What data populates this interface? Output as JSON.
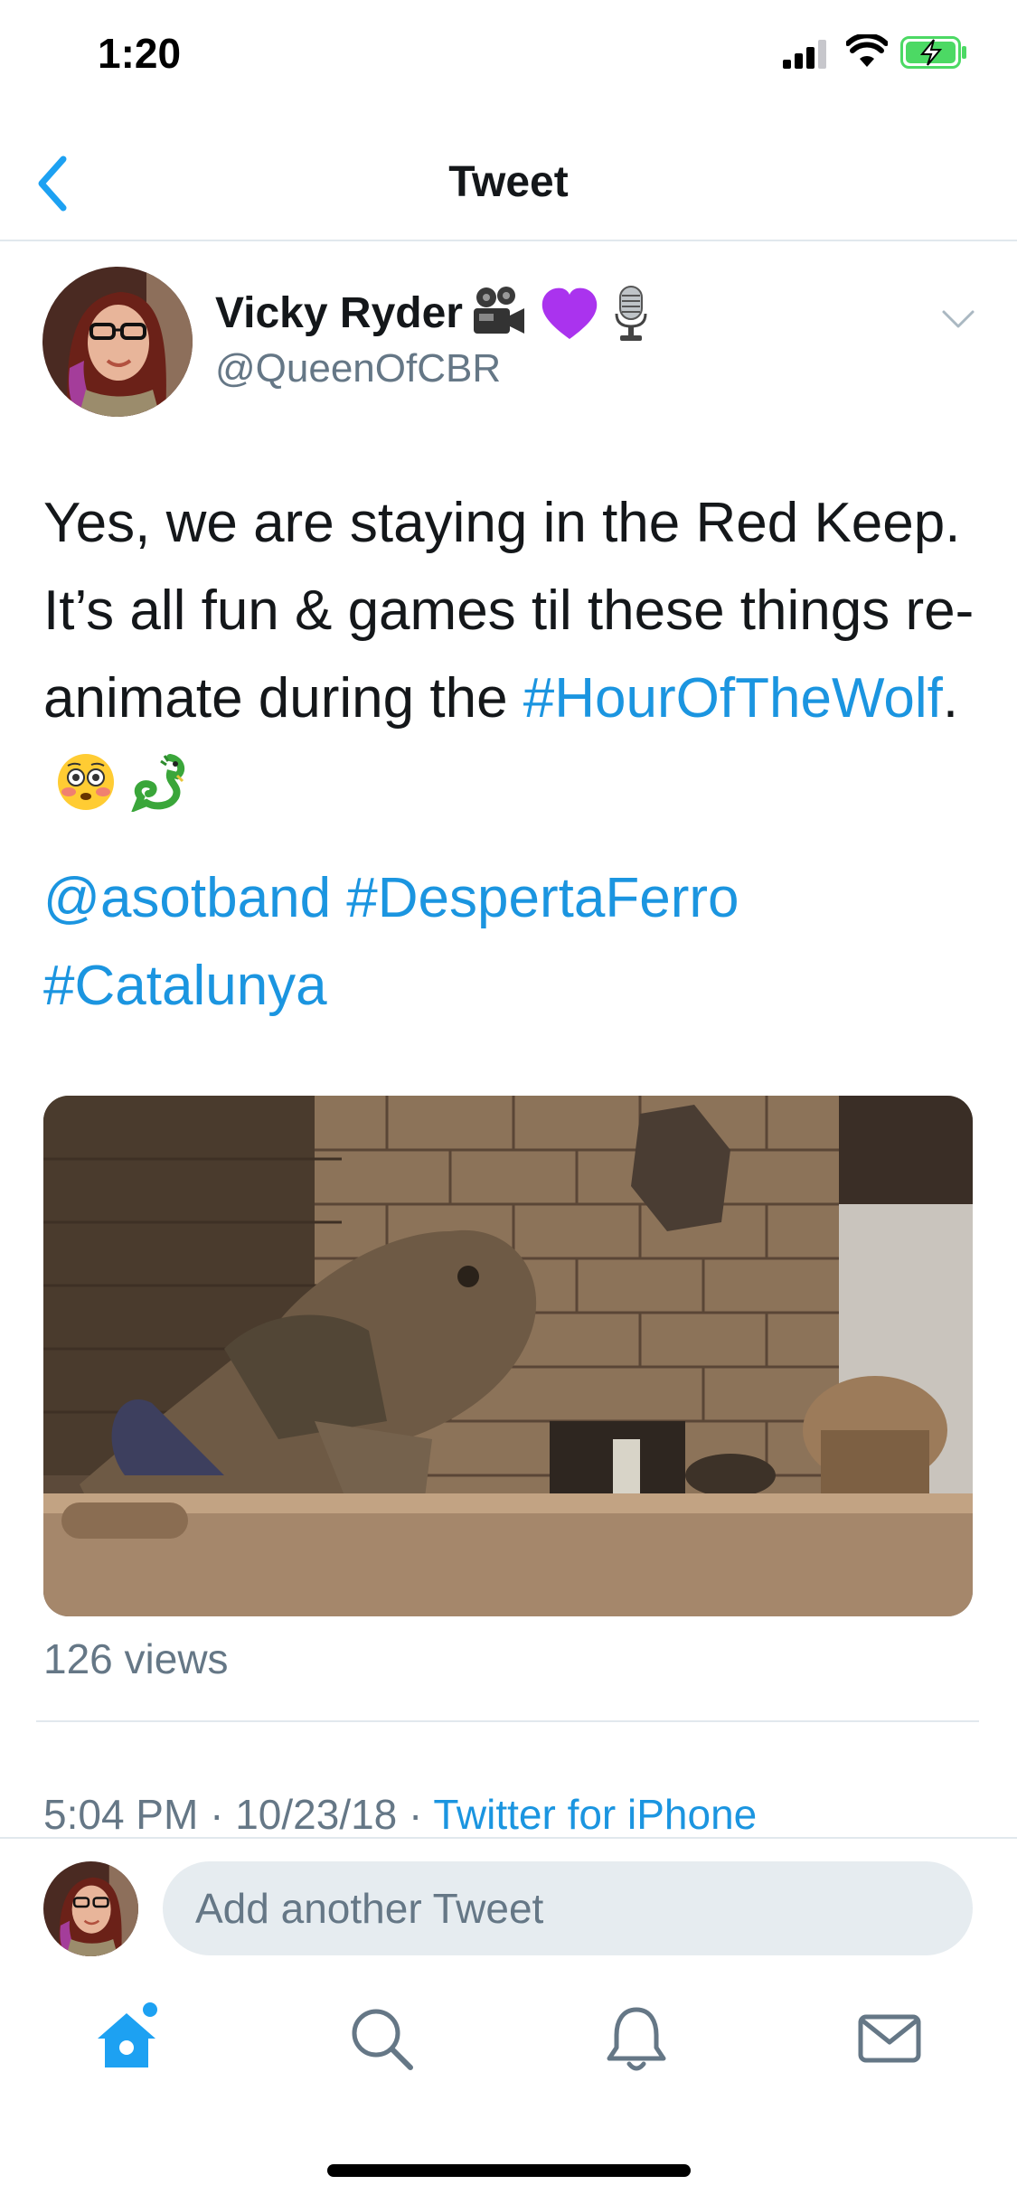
{
  "status_bar": {
    "time": "1:20"
  },
  "nav": {
    "title": "Tweet",
    "back_icon": "chevron-left-icon"
  },
  "tweet": {
    "author_name": "Vicky Ryder",
    "name_emojis": [
      "movie-camera-icon",
      "purple-heart-icon",
      "microphone-icon"
    ],
    "handle": "@QueenOfCBR",
    "text_main": "Yes, we are staying in the Red Keep. It’s all fun & games til these things re-animate during the ",
    "hashtag_wolf": "#HourOfTheWolf",
    "text_after": ".",
    "text_emojis": [
      "flushed-face-icon",
      "dragon-icon"
    ],
    "mention": "@asotband",
    "hashtag_ferro": "#DespertaFerro",
    "hashtag_catalunya": "#Catalunya",
    "views": "126 views",
    "time": "5:04 PM",
    "date": "10/23/18",
    "separator": " · ",
    "source": "Twitter for iPhone"
  },
  "reply": {
    "placeholder": "Add another Tweet"
  },
  "tabs": [
    "home-icon",
    "search-icon",
    "notifications-icon",
    "messages-icon"
  ],
  "colors": {
    "accent": "#1da1f2",
    "link": "#1b95e0",
    "secondary": "#657786",
    "divider": "#e1e8ed",
    "battery": "#4cd964"
  }
}
